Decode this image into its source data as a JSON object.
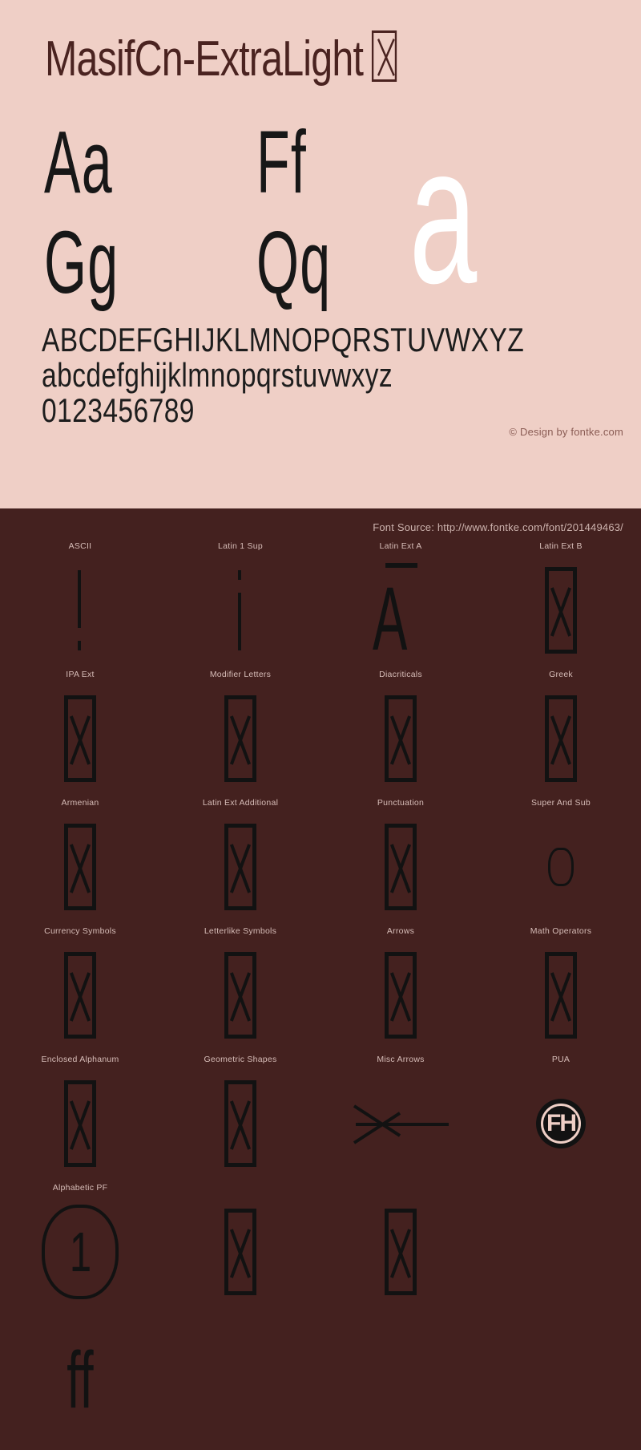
{
  "specimen": {
    "title": "MasifCn-ExtraLight",
    "title_tofu_glyph": "notdef-box",
    "glyph_pairs": [
      "Aa",
      "Ff",
      "Gg",
      "Qq"
    ],
    "watermark_glyph": "a",
    "alphabet_upper": "ABCDEFGHIJKLMNOPQRSTUVWXYZ",
    "alphabet_lower": "abcdefghijklmnopqrstuvwxyz",
    "digits": "0123456789",
    "credit": "© Design by fontke.com"
  },
  "blocks_panel": {
    "source_label": "Font Source: http://www.fontke.com/font/201449463/",
    "cells": [
      {
        "label": "ASCII",
        "sample": "exclam"
      },
      {
        "label": "Latin 1 Sup",
        "sample": "inverted-exclam"
      },
      {
        "label": "Latin Ext A",
        "sample": "A-macron"
      },
      {
        "label": "Latin Ext B",
        "sample": "notdef-box"
      },
      {
        "label": "IPA Ext",
        "sample": "notdef-box"
      },
      {
        "label": "Modifier Letters",
        "sample": "notdef-box"
      },
      {
        "label": "Diacriticals",
        "sample": "notdef-box"
      },
      {
        "label": "Greek",
        "sample": "notdef-box"
      },
      {
        "label": "Armenian",
        "sample": "notdef-box"
      },
      {
        "label": "Latin Ext Additional",
        "sample": "notdef-box"
      },
      {
        "label": "Punctuation",
        "sample": "notdef-box"
      },
      {
        "label": "Super And Sub",
        "sample": "small-o"
      },
      {
        "label": "Currency Symbols",
        "sample": "notdef-box"
      },
      {
        "label": "Letterlike Symbols",
        "sample": "notdef-box"
      },
      {
        "label": "Arrows",
        "sample": "notdef-box"
      },
      {
        "label": "Math Operators",
        "sample": "notdef-box"
      },
      {
        "label": "Enclosed Alphanum",
        "sample": "notdef-box"
      },
      {
        "label": "Geometric Shapes",
        "sample": "notdef-box"
      },
      {
        "label": "Misc Arrows",
        "sample": "left-arrow"
      },
      {
        "label": "PUA",
        "sample": "pua-logo"
      },
      {
        "label": "Alphabetic PF",
        "sample": "circled-one"
      },
      {
        "label": "",
        "sample": "notdef-box"
      },
      {
        "label": "",
        "sample": "notdef-box"
      },
      {
        "label": "",
        "sample": "empty"
      },
      {
        "label": "",
        "sample": "ff-ligature"
      },
      {
        "label": "",
        "sample": "empty"
      },
      {
        "label": "",
        "sample": "empty"
      },
      {
        "label": "",
        "sample": "empty"
      }
    ],
    "ff_ligature": "ff",
    "pua_mark": "FH",
    "circled_number": "1",
    "small_o": "o"
  },
  "colors": {
    "panel_bg": "#efcfc6",
    "dark_bg": "#44211f",
    "title_text": "#4a2320",
    "glyph_ink": "#121212",
    "label_text": "#d7bdb8",
    "credit_text": "#8a5c54",
    "watermark": "#ffffff"
  }
}
